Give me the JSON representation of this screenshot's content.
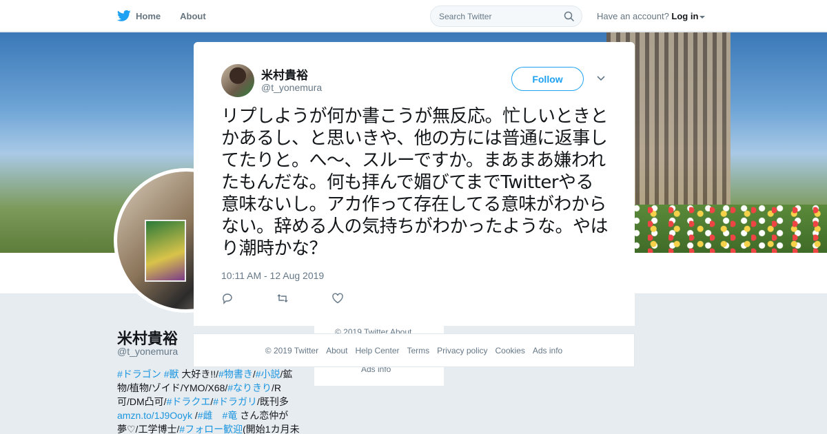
{
  "nav": {
    "home_label": "Home",
    "about_label": "About",
    "search_placeholder": "Search Twitter",
    "account_prompt": "Have an account?",
    "login_label": "Log in"
  },
  "profile": {
    "name": "米村貴裕",
    "handle": "@t_yonemura",
    "bio": {
      "l1_a": "#ドラゴン",
      "l1_b": "#獣",
      "l1_c": " 大好き!!/",
      "l1_d": "#物書き",
      "l1_e": "/",
      "l1_f": "#小説",
      "l1_g": "/鉱",
      "l2": "物/植物/ゾイド/YMO/X68/",
      "l2_b": "#なりきり",
      "l2_c": "/R",
      "l3_a": "可/DM凸可/",
      "l3_b": "#ドラクエ",
      "l3_c": "/",
      "l3_d": "#ドラガリ",
      "l3_e": "/既刊多",
      "l4_a": "amzn.to/1J9Ooyk",
      "l4_b": " /",
      "l4_c": "#雌",
      "l4_d": "　",
      "l4_e": "#竜",
      "l4_f": " さん恋仲が",
      "l5_a": "夢♡/工学博士/",
      "l5_b": "#フォロー歓迎",
      "l5_c": "(開始1カ月未"
    },
    "side_footer_1": "© 2019 Twitter   About",
    "side_footer_2": "Ads info"
  },
  "tweet": {
    "author_name": "米村貴裕",
    "author_handle": "@t_yonemura",
    "follow_label": "Follow",
    "text": "リプしようが何か書こうが無反応。忙しいときとかあるし、と思いきや、他の方には普通に返事してたりと。へ～、スルーですか。まあまあ嫌われたもんだな。何も拝んで媚びてまでTwitterやる意味ないし。アカ作って存在してる意味がわからない。辞める人の気持ちがわかったような。やはり潮時かな？",
    "timestamp": "10:11 AM - 12 Aug 2019"
  },
  "footer": {
    "copyright": "© 2019 Twitter",
    "about": "About",
    "help": "Help Center",
    "terms": "Terms",
    "privacy": "Privacy policy",
    "cookies": "Cookies",
    "ads": "Ads info"
  },
  "colors": {
    "accent": "#1da1f2",
    "link": "#1b95e0",
    "background": "#e6ecf0"
  }
}
